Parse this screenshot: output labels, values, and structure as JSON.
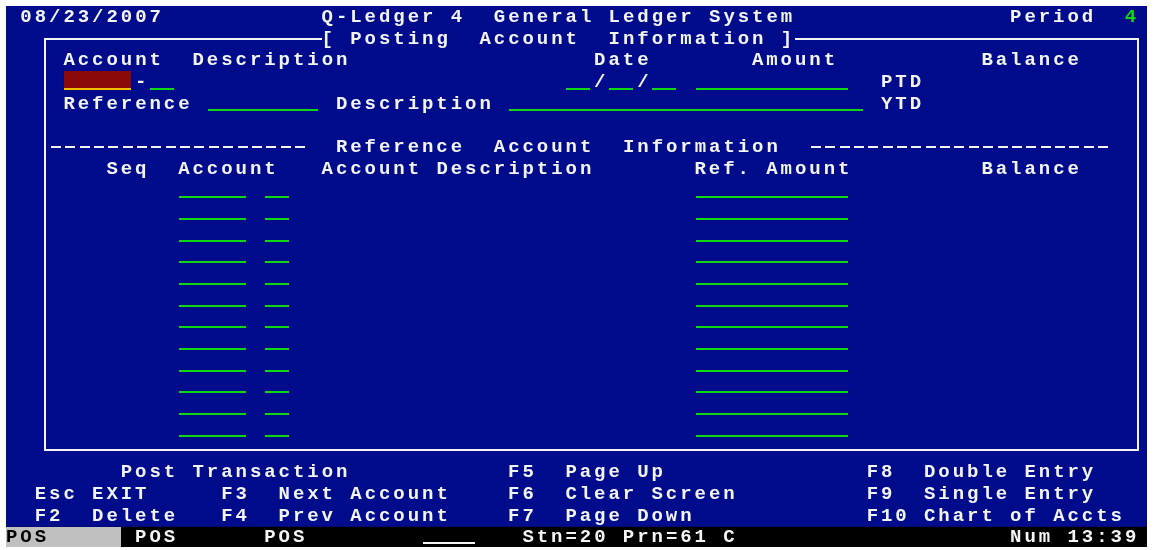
{
  "header": {
    "date": "08/23/2007",
    "title": "Q-Ledger 4  General Ledger System",
    "period_label": "Period",
    "period_value": "4"
  },
  "panel": {
    "title": "[ Posting  Account  Information ]",
    "posting_headings": [
      "Account",
      "Description",
      "Date",
      "Amount",
      "Balance"
    ],
    "account_field": {
      "focused": true
    },
    "account_separator": "-",
    "sub_account_field": {
      "focused": false
    },
    "date_fields": [
      {
        "focused": false
      },
      {
        "focused": false
      },
      {
        "focused": false
      }
    ],
    "date_separators": [
      "/",
      "/"
    ],
    "amount_field": {
      "focused": false
    },
    "ptd_label": "PTD",
    "reference_label": "Reference",
    "reference_field": {
      "focused": false
    },
    "description_label": "Description",
    "description_field": {
      "focused": false
    },
    "ytd_label": "YTD",
    "section_title": "Reference  Account  Information",
    "columns": [
      "Seq",
      "Account",
      "Account Description",
      "Ref. Amount",
      "Balance"
    ],
    "entry_rows": [
      {
        "focused": false
      },
      {
        "focused": false
      },
      {
        "focused": false
      },
      {
        "focused": false
      },
      {
        "focused": false
      },
      {
        "focused": false
      },
      {
        "focused": false
      },
      {
        "focused": false
      },
      {
        "focused": false
      },
      {
        "focused": false
      },
      {
        "focused": false
      },
      {
        "focused": false
      }
    ]
  },
  "function_keys": [
    {
      "label": "Post Transaction"
    },
    {
      "key": "F5",
      "label": "Page Up"
    },
    {
      "key": "F8",
      "label": "Double Entry"
    },
    {
      "key": "Esc",
      "label": "EXIT"
    },
    {
      "key": "F3",
      "label": "Next Account"
    },
    {
      "key": "F6",
      "label": "Clear Screen"
    },
    {
      "key": "F9",
      "label": "Single Entry"
    },
    {
      "key": "F2",
      "label": "Delete"
    },
    {
      "key": "F4",
      "label": "Prev Account"
    },
    {
      "key": "F7",
      "label": "Page Down"
    },
    {
      "key": "F10",
      "label": "Chart of Accts"
    }
  ],
  "status_bar": {
    "segments": [
      {
        "text": "POS",
        "highlighted": true
      },
      {
        "text": "POS",
        "highlighted": false
      },
      {
        "text": "POS",
        "highlighted": false
      }
    ],
    "input": {
      "focused": false
    },
    "station": "Stn=20 Prn=61 C",
    "clock": "Num 13:39"
  }
}
